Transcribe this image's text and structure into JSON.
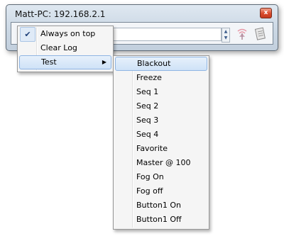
{
  "window": {
    "title": "Matt-PC:  192.168.2.1",
    "close_glyph": "x",
    "spin_up": "▲",
    "spin_down": "▼"
  },
  "context_menu": {
    "items": [
      {
        "label": "Always on top",
        "checked": true,
        "check_glyph": "✔"
      },
      {
        "label": "Clear Log"
      },
      {
        "label": "Test",
        "submenu_arrow": "▶"
      }
    ]
  },
  "test_submenu": {
    "items": [
      {
        "label": "Blackout"
      },
      {
        "label": "Freeze"
      },
      {
        "label": "Seq 1"
      },
      {
        "label": "Seq 2"
      },
      {
        "label": "Seq 3"
      },
      {
        "label": "Seq 4"
      },
      {
        "label": "Favorite"
      },
      {
        "label": "Master @ 100"
      },
      {
        "label": "Fog On"
      },
      {
        "label": "Fog off"
      },
      {
        "label": "Button1 On"
      },
      {
        "label": "Button1 Off"
      }
    ]
  },
  "colors": {
    "highlight_border": "#8fb5e3",
    "close_button": "#d9482a"
  },
  "icons": [
    "close-icon",
    "checkmark-icon",
    "submenu-arrow-icon",
    "signal-tool-icon",
    "document-tool-icon"
  ]
}
